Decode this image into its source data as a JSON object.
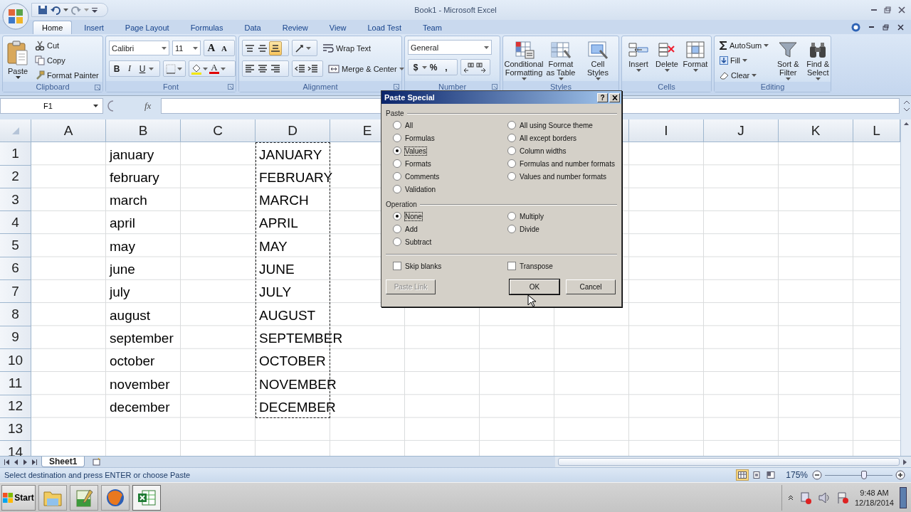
{
  "window": {
    "title": "Book1 - Microsoft Excel"
  },
  "ribbon_tabs": [
    {
      "label": "Home",
      "selected": true
    },
    {
      "label": "Insert",
      "selected": false
    },
    {
      "label": "Page Layout",
      "selected": false
    },
    {
      "label": "Formulas",
      "selected": false
    },
    {
      "label": "Data",
      "selected": false
    },
    {
      "label": "Review",
      "selected": false
    },
    {
      "label": "View",
      "selected": false
    },
    {
      "label": "Load Test",
      "selected": false
    },
    {
      "label": "Team",
      "selected": false
    }
  ],
  "ribbon_groups": [
    {
      "kind": "clipboard",
      "label": "Clipboard",
      "large": "Paste",
      "small": [
        "Cut",
        "Copy",
        "Format Painter"
      ]
    },
    {
      "kind": "font",
      "label": "Font",
      "font": "Calibri",
      "size": "11",
      "size_buttons": [
        "A",
        "A"
      ],
      "styles": [
        "B",
        "I",
        "U"
      ],
      "font_color": "A"
    },
    {
      "kind": "alignment",
      "label": "Alignment",
      "vertical": [
        {
          "kind": "top",
          "selected": false
        },
        {
          "kind": "middle",
          "selected": false
        },
        {
          "kind": "bottom",
          "selected": true
        }
      ],
      "wide": [
        "Wrap Text",
        "Merge & Center"
      ]
    },
    {
      "kind": "number",
      "label": "Number",
      "format": "General",
      "symbols": [
        "$",
        "%",
        ","
      ]
    },
    {
      "kind": "large",
      "label": "Styles",
      "buttons": [
        {
          "label": "Conditional Formatting",
          "kind": "conditional"
        },
        {
          "label": "Format as Table",
          "kind": "table"
        },
        {
          "label": "Cell Styles",
          "kind": "styles"
        }
      ]
    },
    {
      "kind": "large",
      "label": "Cells",
      "buttons": [
        {
          "label": "Insert",
          "kind": "insert"
        },
        {
          "label": "Delete",
          "kind": "delete"
        },
        {
          "label": "Format",
          "kind": "format"
        }
      ]
    },
    {
      "kind": "editing",
      "label": "Editing",
      "small": [
        {
          "label": "AutoSum",
          "kind": "sum"
        },
        {
          "label": "Fill",
          "kind": "fill"
        },
        {
          "label": "Clear",
          "kind": "clear"
        }
      ],
      "buttons": [
        {
          "label": "Sort & Filter",
          "kind": "sort"
        },
        {
          "label": "Find & Select",
          "kind": "find"
        }
      ]
    }
  ],
  "formula_bar": {
    "name_box": "F1",
    "function_label": "fx"
  },
  "sheet": {
    "copy_marquee": true,
    "columns": [
      {
        "label": "A"
      },
      {
        "label": "B"
      },
      {
        "label": "C"
      },
      {
        "label": "D"
      },
      {
        "label": "E"
      },
      {
        "kind": "covered"
      },
      {
        "label": "I"
      },
      {
        "label": "J"
      },
      {
        "label": "K"
      },
      {
        "label": "L"
      }
    ],
    "rows": [
      {
        "number": "1",
        "column_b": "january",
        "column_d": "JANUARY"
      },
      {
        "number": "2",
        "column_b": "february",
        "column_d": "FEBRUARY"
      },
      {
        "number": "3",
        "column_b": "march",
        "column_d": "MARCH"
      },
      {
        "number": "4",
        "column_b": "april",
        "column_d": "APRIL"
      },
      {
        "number": "5",
        "column_b": "may",
        "column_d": "MAY"
      },
      {
        "number": "6",
        "column_b": "june",
        "column_d": "JUNE"
      },
      {
        "number": "7",
        "column_b": "july",
        "column_d": "JULY"
      },
      {
        "number": "8",
        "column_b": "august",
        "column_d": "AUGUST"
      },
      {
        "number": "9",
        "column_b": "september",
        "column_d": "SEPTEMBER"
      },
      {
        "number": "10",
        "column_b": "october",
        "column_d": "OCTOBER"
      },
      {
        "number": "11",
        "column_b": "november",
        "column_d": "NOVEMBER"
      },
      {
        "number": "12",
        "column_b": "december",
        "column_d": "DECEMBER"
      },
      {
        "number": "13"
      },
      {
        "number": "14"
      }
    ]
  },
  "sheet_tabs": [
    {
      "label": "Sheet1",
      "selected": true
    }
  ],
  "status_bar": {
    "message": "Select destination and press ENTER or choose Paste",
    "views": [
      {
        "kind": "normal",
        "selected": true
      },
      {
        "kind": "layout",
        "selected": false
      },
      {
        "kind": "break",
        "selected": false
      }
    ],
    "zoom": "175%",
    "zoom_slider": {
      "level": 0.58
    }
  },
  "dialog": {
    "title": "Paste Special",
    "help": "?",
    "paste_label": "Paste",
    "paste_options": [
      {
        "label": "All",
        "selected": false
      },
      {
        "label": "Formulas",
        "selected": false
      },
      {
        "label": "Values",
        "selected": true
      },
      {
        "label": "Formats",
        "selected": false
      },
      {
        "label": "Comments",
        "selected": false
      },
      {
        "label": "Validation",
        "selected": false
      },
      {
        "label": "All using Source theme",
        "selected": false
      },
      {
        "label": "All except borders",
        "selected": false
      },
      {
        "label": "Column widths",
        "selected": false
      },
      {
        "label": "Formulas and number formats",
        "selected": false
      },
      {
        "label": "Values and number formats",
        "selected": false
      }
    ],
    "operation_label": "Operation",
    "operation_options": [
      {
        "label": "None",
        "selected": true
      },
      {
        "label": "Add",
        "selected": false
      },
      {
        "label": "Subtract",
        "selected": false
      },
      {
        "label": "Multiply",
        "selected": false
      },
      {
        "label": "Divide",
        "selected": false
      }
    ],
    "checkboxes": [
      {
        "label": "Skip blanks",
        "checked": false
      },
      {
        "label": "Transpose",
        "checked": false
      }
    ],
    "buttons": [
      {
        "label": "Paste Link",
        "disabled": true,
        "default": false
      },
      {
        "label": "OK",
        "disabled": false,
        "default": true
      },
      {
        "label": "Cancel",
        "disabled": false,
        "default": false
      }
    ]
  },
  "taskbar": {
    "start": "Start",
    "apps": [
      {
        "kind": "folder",
        "active": false
      },
      {
        "kind": "editor",
        "active": false
      },
      {
        "kind": "browser",
        "active": false
      },
      {
        "kind": "spreadsheet",
        "active": true
      }
    ],
    "time": "9:48 AM",
    "date": "12/18/2014"
  }
}
